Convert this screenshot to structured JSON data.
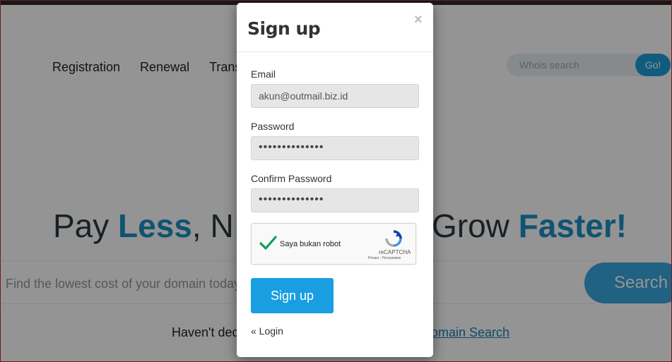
{
  "nav": {
    "items": [
      {
        "label": "Registration"
      },
      {
        "label": "Renewal"
      },
      {
        "label": "Trans"
      }
    ]
  },
  "whois": {
    "placeholder": "Whois search",
    "go_label": "Go!"
  },
  "hero": {
    "part1_a": "Pay ",
    "part1_b": "Less",
    "part1_c": ", N",
    "part2_a": "Grow ",
    "part2_b": "Faster!"
  },
  "domain_search": {
    "placeholder": "Find the lowest cost of your domain today",
    "button_label": "Search"
  },
  "footer_text": {
    "undecided": "Haven't dec",
    "domain_search_link": "omain Search"
  },
  "modal": {
    "title": "Sign up",
    "close_glyph": "×",
    "email": {
      "label": "Email",
      "value": "akun@outmail.biz.id"
    },
    "password": {
      "label": "Password",
      "value": "••••••••••••••"
    },
    "confirm": {
      "label": "Confirm Password",
      "value": "••••••••••••••"
    },
    "captcha": {
      "text": "Saya bukan robot",
      "brand": "reCAPTCHA",
      "terms": "Privasi - Persyaratan"
    },
    "submit_label": "Sign up",
    "login_link": "« Login"
  },
  "colors": {
    "accent": "#1a9ee2",
    "hero_highlight": "#1d8fc4",
    "check": "#0f9d58"
  }
}
